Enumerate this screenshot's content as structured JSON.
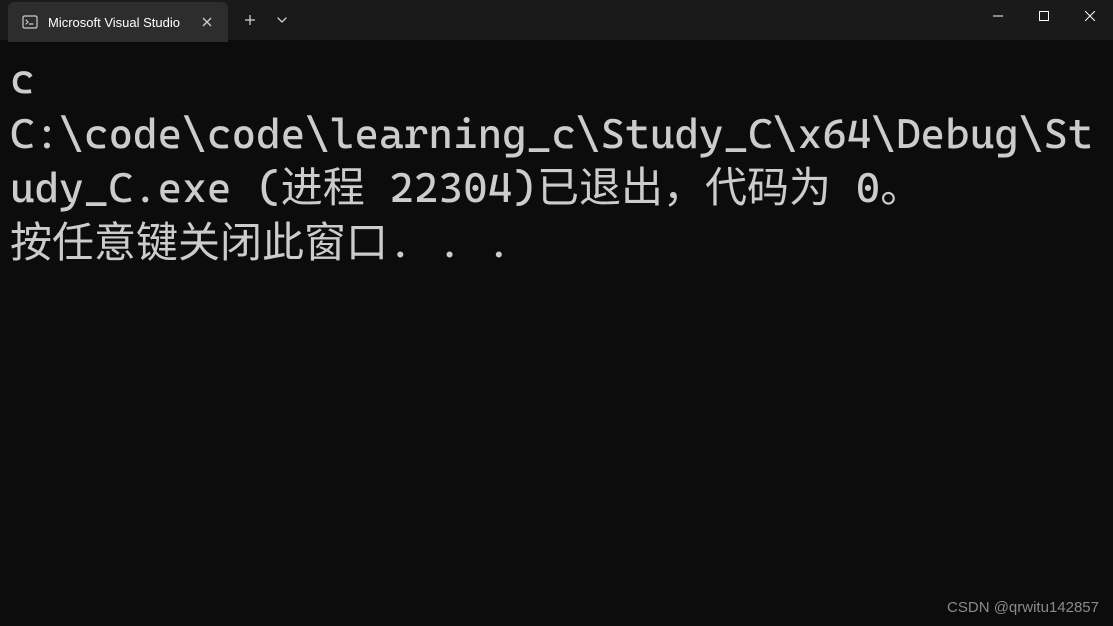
{
  "tab": {
    "title": "Microsoft Visual Studio"
  },
  "terminal": {
    "line1": "c",
    "line2": "C:\\code\\code\\learning_c\\Study_C\\x64\\Debug\\Study_C.exe (进程 22304)已退出，代码为 0。",
    "line3": "按任意键关闭此窗口. . ."
  },
  "watermark": "CSDN @qrwitu142857"
}
